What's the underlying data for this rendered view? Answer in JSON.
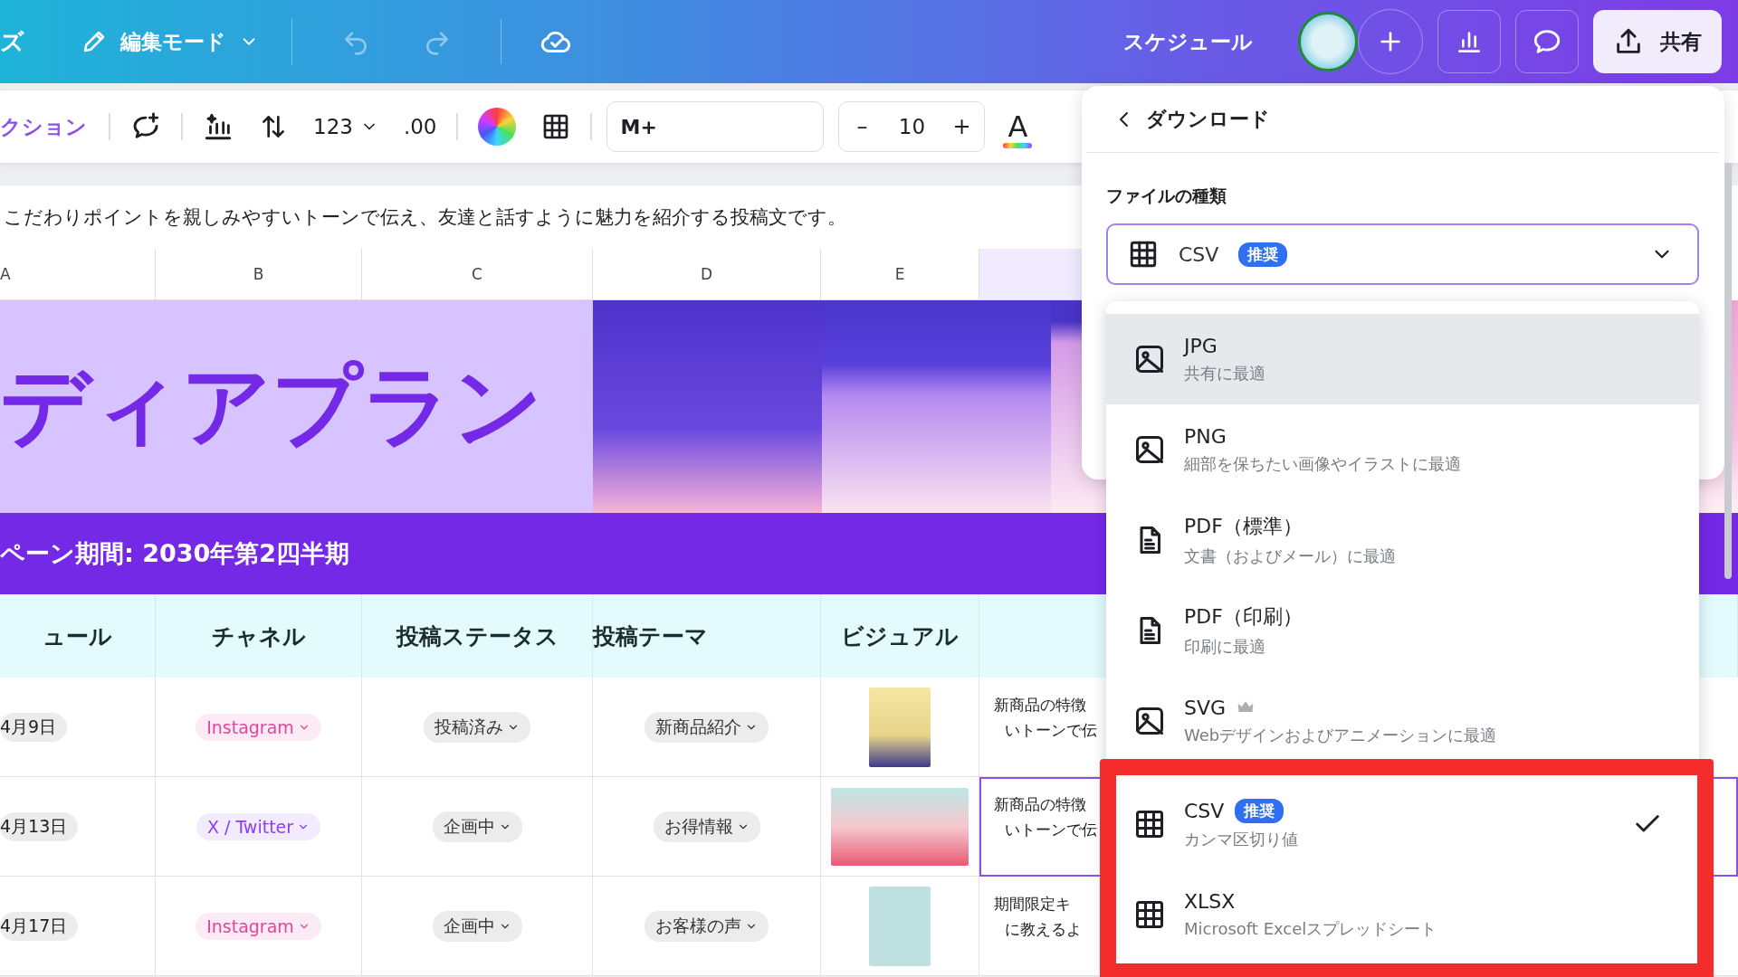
{
  "top_bar": {
    "cut_label": "ズ",
    "mode_button": "編集モード",
    "schedule_link": "スケジュール",
    "share_button": "共有"
  },
  "toolbar": {
    "action_label": "クション",
    "number_format": "123",
    "decimal_button": ".00",
    "font_name": "M+",
    "size_decrease": "–",
    "font_size": "10",
    "size_increase": "+",
    "text_color_button": "A"
  },
  "description": "こだわりポイントを親しみやすいトーンで伝え、友達と話すように魅力を紹介する投稿文です。",
  "sheet": {
    "column_letters": [
      "A",
      "B",
      "C",
      "D",
      "E"
    ],
    "title": "ディアプラン",
    "period": "ペーン期間: 2030年第2四半期",
    "headers": [
      "ュール",
      "チャネル",
      "投稿ステータス",
      "投稿テーマ",
      "ビジュアル"
    ],
    "rows": [
      {
        "date": "4月9日",
        "channel": {
          "label": "Instagram",
          "color": "#e0479e"
        },
        "status": "投稿済み",
        "theme": "新商品紹介",
        "text_lines": [
          "新商品の特徴",
          "いトーンで伝"
        ],
        "selected": false
      },
      {
        "date": "4月13日",
        "channel": {
          "label": "X / Twitter",
          "color": "#8b3ff0"
        },
        "status": "企画中",
        "theme": "お得情報",
        "text_lines": [
          "新商品の特徴",
          "いトーンで伝"
        ],
        "selected": true
      },
      {
        "date": "4月17日",
        "channel": {
          "label": "Instagram",
          "color": "#e0479e"
        },
        "status": "企画中",
        "theme": "お客様の声",
        "text_lines": [
          "期間限定キ",
          "に教えるよ"
        ],
        "selected": false
      }
    ]
  },
  "download_panel": {
    "title": "ダウンロード",
    "file_type_label": "ファイルの種類",
    "select": {
      "value": "CSV",
      "badge": "推奨"
    },
    "options": [
      {
        "kind": "image",
        "label": "JPG",
        "description": "共有に最適",
        "hovered": true,
        "selected": false,
        "premium": false,
        "highlighted": false
      },
      {
        "kind": "image",
        "label": "PNG",
        "description": "細部を保ちたい画像やイラストに最適",
        "hovered": false,
        "selected": false,
        "premium": false,
        "highlighted": false
      },
      {
        "kind": "document",
        "label": "PDF（標準）",
        "description": "文書（およびメール）に最適",
        "hovered": false,
        "selected": false,
        "premium": false,
        "highlighted": false
      },
      {
        "kind": "document",
        "label": "PDF（印刷）",
        "description": "印刷に最適",
        "hovered": false,
        "selected": false,
        "premium": false,
        "highlighted": false
      },
      {
        "kind": "image",
        "label": "SVG",
        "description": "Webデザインおよびアニメーションに最適",
        "hovered": false,
        "selected": false,
        "premium": true,
        "highlighted": false
      },
      {
        "kind": "table",
        "label": "CSV",
        "badge": "推奨",
        "description": "カンマ区切り値",
        "hovered": false,
        "selected": true,
        "premium": false,
        "highlighted": true
      },
      {
        "kind": "table",
        "label": "XLSX",
        "description": "Microsoft Excelスプレッドシート",
        "hovered": false,
        "selected": false,
        "premium": false,
        "highlighted": true
      }
    ]
  }
}
